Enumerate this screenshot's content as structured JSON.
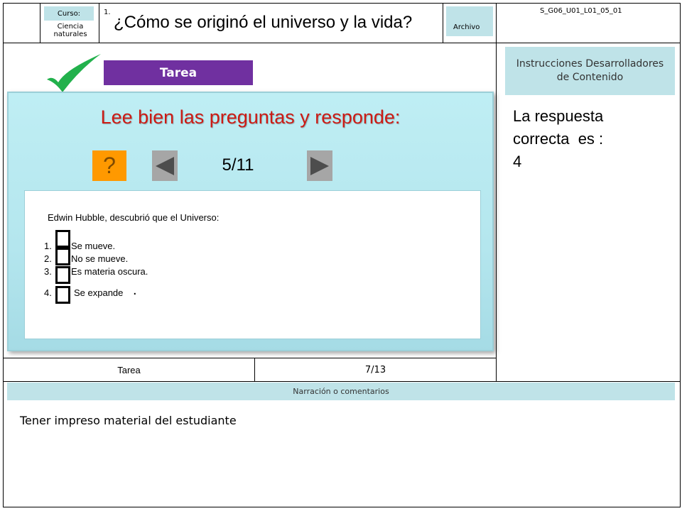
{
  "header": {
    "course_label": "Curso:",
    "course_value": "Ciencia naturales",
    "lesson_number": "1.",
    "title": "¿Cómo se originó el universo y la vida?",
    "archive_label": "Archivo",
    "code": "S_G06_U01_L01_05_01"
  },
  "task_badge": "Tarea",
  "panel": {
    "heading": "Lee bien las preguntas y responde:",
    "help_label": "?",
    "progress": "5/11",
    "question": "Edwin Hubble, descubrió que el Universo:",
    "options": [
      {
        "number": "1.",
        "text": "Se mueve."
      },
      {
        "number": "2.",
        "text": "No se mueve."
      },
      {
        "number": "3.",
        "text": "Es materia oscura."
      },
      {
        "number": "4.",
        "text": "Se expande",
        "suffix": "."
      }
    ]
  },
  "instructions": {
    "title": "Instrucciones Desarrolladores de Contenido",
    "answer_text": "La respuesta correcta  es :",
    "answer_value": "4"
  },
  "footer_row": {
    "type": "Tarea",
    "page": "7/13"
  },
  "narration": {
    "label": "Narración o comentarios",
    "text": "Tener impreso material del estudiante"
  },
  "colors": {
    "heading_red": "#cc1a14",
    "badge_purple": "#7030a0",
    "help_orange": "#ff9900",
    "check_green": "#22b14c",
    "cell_cyan": "#bfe3e8"
  }
}
